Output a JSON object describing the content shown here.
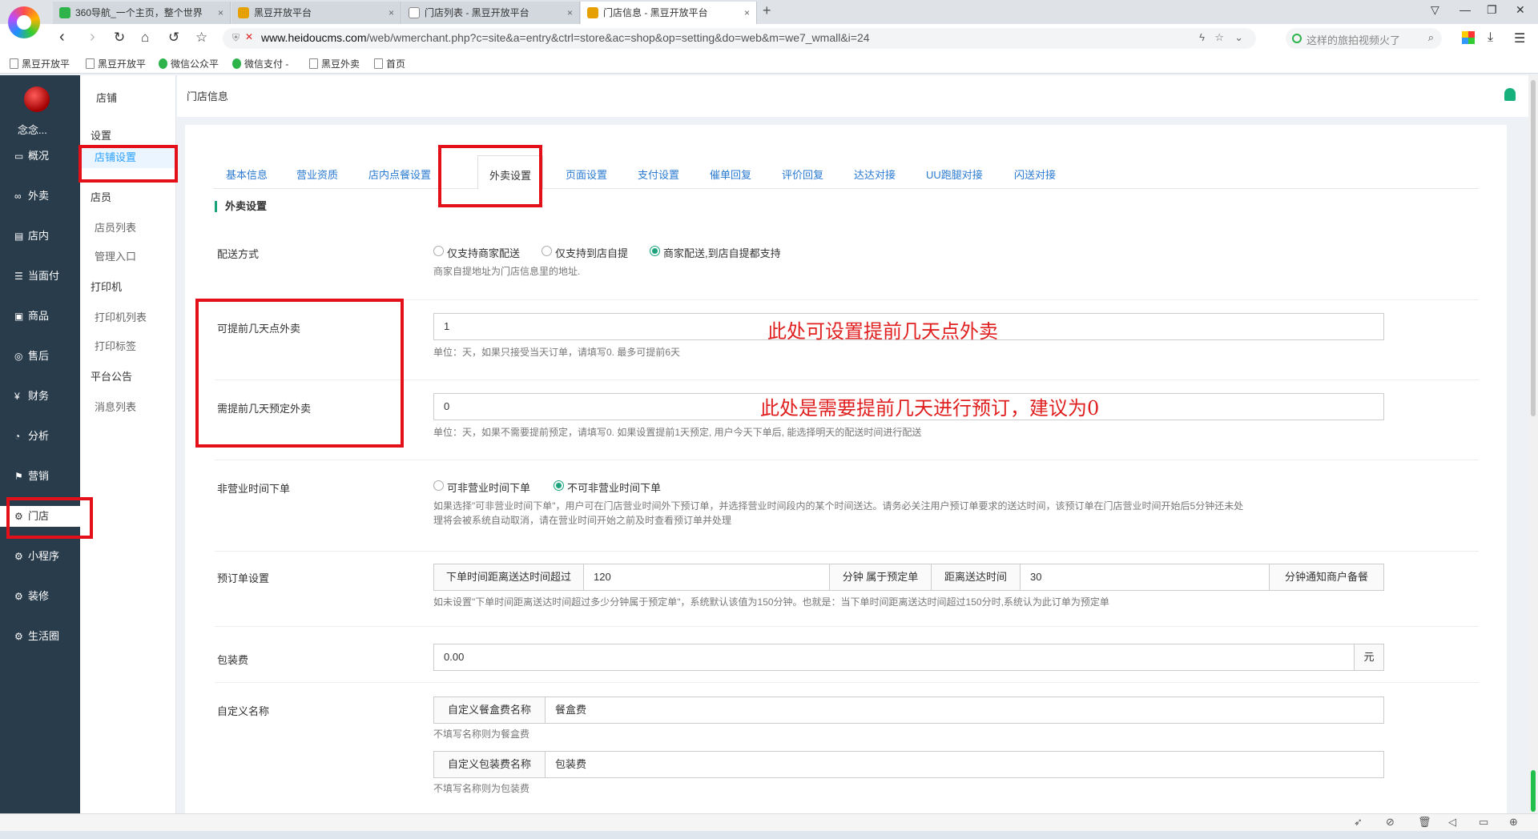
{
  "browser": {
    "tabs": [
      {
        "title": "360导航_一个主页，整个世界",
        "fav": "#2db34a"
      },
      {
        "title": "黑豆开放平台",
        "fav": "#e6a100"
      },
      {
        "title": "门店列表 - 黑豆开放平台",
        "fav": ""
      },
      {
        "title": "门店信息 - 黑豆开放平台",
        "fav": "#e6a100"
      }
    ],
    "new_tab": "+",
    "url_host": "www.heidoucms.com",
    "url_path": "/web/wmerchant.php?c=site&a=entry&ctrl=store&ac=shop&op=setting&do=web&m=we7_wmall&i=24",
    "search_placeholder": "这样的旅拍视频火了",
    "bookmarks": [
      "黑豆开放平",
      "黑豆开放平",
      "微信公众平",
      "微信支付 -",
      "黑豆外卖",
      "首页"
    ]
  },
  "sidebar": {
    "user": "念念...",
    "items": [
      {
        "label": "概况",
        "icon": "▭"
      },
      {
        "label": "外卖",
        "icon": "∞"
      },
      {
        "label": "店内",
        "icon": "▤"
      },
      {
        "label": "当面付",
        "icon": "☰"
      },
      {
        "label": "商品",
        "icon": "▣"
      },
      {
        "label": "售后",
        "icon": "◎"
      },
      {
        "label": "财务",
        "icon": "¥"
      },
      {
        "label": "分析",
        "icon": "◔"
      },
      {
        "label": "营销",
        "icon": "⚑"
      },
      {
        "label": "门店",
        "icon": "⚙"
      },
      {
        "label": "小程序",
        "icon": "⚙"
      },
      {
        "label": "装修",
        "icon": "⚙"
      },
      {
        "label": "生活圈",
        "icon": "⚙"
      }
    ]
  },
  "subside": {
    "title": "店铺",
    "groups": [
      {
        "heading": "设置",
        "items": [
          "店铺设置"
        ]
      },
      {
        "heading": "店员",
        "items": [
          "店员列表",
          "管理入口"
        ]
      },
      {
        "heading": "打印机",
        "items": [
          "打印机列表",
          "打印标签"
        ]
      },
      {
        "heading": "平台公告",
        "items": [
          "消息列表"
        ]
      }
    ]
  },
  "topbar": {
    "breadcrumb": "门店信息"
  },
  "tabs": [
    "基本信息",
    "营业资质",
    "店内点餐设置",
    "外卖设置",
    "页面设置",
    "支付设置",
    "催单回复",
    "评价回复",
    "达达对接",
    "UU跑腿对接",
    "闪送对接"
  ],
  "form": {
    "section_title": "外卖设置",
    "delivery": {
      "label": "配送方式",
      "options": [
        "仅支持商家配送",
        "仅支持到店自提",
        "商家配送,到店自提都支持"
      ],
      "selected": 2,
      "help": "商家自提地址为门店信息里的地址."
    },
    "advance_days": {
      "label": "可提前几天点外卖",
      "value": "1",
      "help": "单位：天，如果只接受当天订单，请填写0. 最多可提前6天",
      "annotation": "此处可设置提前几天点外卖"
    },
    "reserve_days": {
      "label": "需提前几天预定外卖",
      "value": "0",
      "help": "单位：天，如果不需要提前预定，请填写0. 如果设置提前1天预定, 用户今天下单后, 能选择明天的配送时间进行配送",
      "annotation": "此处是需要提前几天进行预订，建议为0"
    },
    "off_hours": {
      "label": "非营业时间下单",
      "options": [
        "可非营业时间下单",
        "不可非营业时间下单"
      ],
      "selected": 1,
      "help1": "如果选择\"可非营业时间下单\"，用户可在门店营业时间外下预订单，并选择营业时间段内的某个时间送达。请务必关注用户预订单要求的送达时间，该预订单在门店营业时间开始后5分钟还未处",
      "help2": "理将会被系统自动取消，请在营业时间开始之前及时查看预订单并处理"
    },
    "preorder": {
      "label": "预订单设置",
      "prefix": "下单时间距离送达时间超过",
      "value1": "120",
      "mid": "分钟 属于预定单",
      "prefix2": "距离送达时间",
      "value2": "30",
      "suffix": "分钟通知商户备餐",
      "help": "如未设置\"下单时间距离送达时间超过多少分钟属于预定单\"，系统默认该值为150分钟。也就是：当下单时间距离送达时间超过150分时,系统认为此订单为预定单"
    },
    "packing_fee": {
      "label": "包装费",
      "value": "0.00",
      "unit": "元"
    },
    "custom_names": {
      "label": "自定义名称",
      "box_prefix": "自定义餐盒费名称",
      "box_value": "餐盒费",
      "box_help": "不填写名称则为餐盒费",
      "pack_prefix": "自定义包装费名称",
      "pack_value": "包装费",
      "pack_help": "不填写名称则为包装费"
    }
  },
  "colors": {
    "accent": "#1aa37a",
    "link": "#2a7ad1",
    "sidebar": "#293c4c",
    "highlight": "#e3101a",
    "annotation": "#e02020"
  }
}
